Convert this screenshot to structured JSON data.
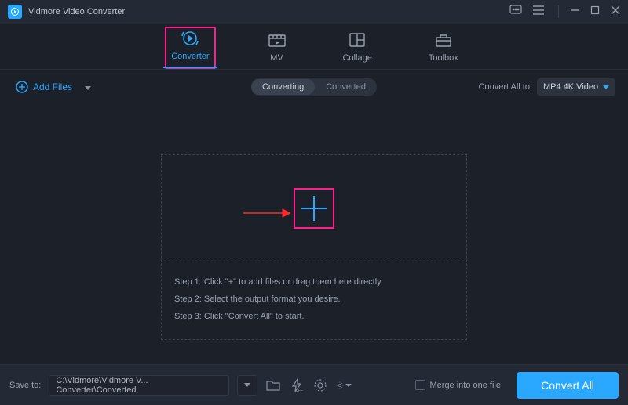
{
  "app": {
    "title": "Vidmore Video Converter"
  },
  "tabs": {
    "converter": "Converter",
    "mv": "MV",
    "collage": "Collage",
    "toolbox": "Toolbox"
  },
  "subbar": {
    "add_files": "Add Files",
    "converting": "Converting",
    "converted": "Converted",
    "convert_all_to_label": "Convert All to:",
    "format": "MP4 4K Video"
  },
  "steps": {
    "s1": "Step 1: Click \"+\" to add files or drag them here directly.",
    "s2": "Step 2: Select the output format you desire.",
    "s3": "Step 3: Click \"Convert All\" to start."
  },
  "bottom": {
    "save_to_label": "Save to:",
    "path": "C:\\Vidmore\\Vidmore V... Converter\\Converted",
    "merge_label": "Merge into one file",
    "convert_button": "Convert All"
  }
}
